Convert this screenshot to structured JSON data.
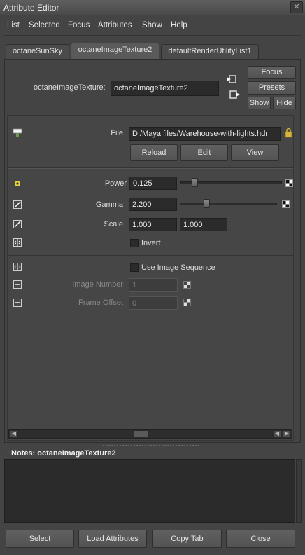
{
  "window": {
    "title": "Attribute Editor",
    "close_glyph": "✕"
  },
  "menu": [
    "List",
    "Selected",
    "Focus",
    "Attributes",
    "Show",
    "Help"
  ],
  "tabs": [
    {
      "label": "octaneSunSky",
      "active": false
    },
    {
      "label": "octaneImageTexture2",
      "active": true
    },
    {
      "label": "defaultRenderUtilityList1",
      "active": false
    }
  ],
  "node": {
    "type_label": "octaneImageTexture:",
    "name_value": "octaneImageTexture2"
  },
  "side_buttons": {
    "focus": "Focus",
    "presets": "Presets",
    "show": "Show",
    "hide": "Hide"
  },
  "file": {
    "label": "File",
    "path": "D:/Maya files/Warehouse-with-lights.hdr",
    "reload": "Reload",
    "edit": "Edit",
    "view": "View"
  },
  "attrs": {
    "power": {
      "label": "Power",
      "value": "0.125",
      "slider_fraction": 0.14
    },
    "gamma": {
      "label": "Gamma",
      "value": "2.200",
      "slider_fraction": 0.27
    },
    "scale": {
      "label": "Scale",
      "value_u": "1.000",
      "value_v": "1.000"
    },
    "invert": {
      "label": "Invert",
      "checked": false
    }
  },
  "sequence": {
    "use_label": "Use Image Sequence",
    "checked": false,
    "image_number": {
      "label": "Image Number",
      "value": "1"
    },
    "frame_offset": {
      "label": "Frame Offset",
      "value": "0"
    }
  },
  "notes": {
    "label": "Notes:  octaneImageTexture2",
    "text": ""
  },
  "bottom_buttons": {
    "select": "Select",
    "load": "Load Attributes",
    "copy": "Copy Tab",
    "close": "Close"
  },
  "colors": {
    "background": "#444444",
    "field": "#2b2b2b",
    "button": "#5a5a5a",
    "accent": "#e6d23a"
  },
  "icons": [
    "close-icon",
    "input-connection-icon",
    "output-connection-icon",
    "texture-icon",
    "power-dot-icon",
    "curve-icon",
    "scale-icon",
    "invert-icon",
    "sequence-icon",
    "image-number-icon",
    "frame-offset-icon",
    "map-button-icon",
    "scroll-left-icon",
    "scroll-right-icon"
  ]
}
